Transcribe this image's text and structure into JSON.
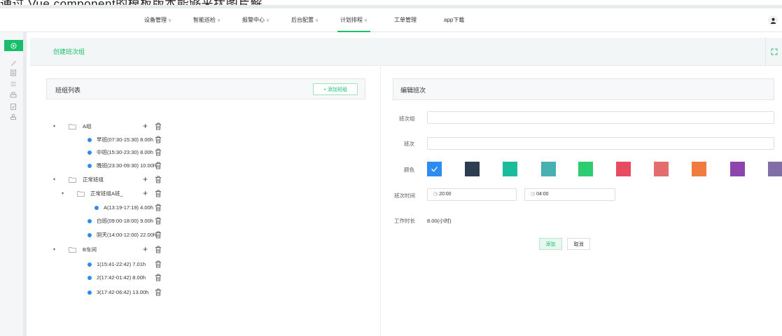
{
  "top_strip_text": "通过 Vue.component的模板版本能够来扰图片解",
  "nav": {
    "items": [
      {
        "label": "设备管理",
        "has_dropdown": true
      },
      {
        "label": "智能巡检",
        "has_dropdown": true
      },
      {
        "label": "报警中心",
        "has_dropdown": true
      },
      {
        "label": "后台配置",
        "has_dropdown": true
      },
      {
        "label": "计划排程",
        "has_dropdown": true,
        "active": true
      },
      {
        "label": "工单管理",
        "has_dropdown": false
      },
      {
        "label": "app下载",
        "has_dropdown": false
      }
    ]
  },
  "sidebar": {
    "icons": [
      "plus-circle-icon",
      "pen-icon",
      "document-icon",
      "list-icon",
      "print-icon",
      "clipboard-check-icon",
      "stamp-icon"
    ]
  },
  "page": {
    "title": "创建班次组"
  },
  "left_panel": {
    "title": "班组列表",
    "add_group_label": "+ 添加班组"
  },
  "tree": [
    {
      "level": 0,
      "type": "group",
      "label": "A组",
      "expanded": true
    },
    {
      "level": 1,
      "type": "shift",
      "label": "早班(07:30-15:30) 8.00h"
    },
    {
      "level": 1,
      "type": "shift",
      "label": "中班(15:30-23:30) 8.00h"
    },
    {
      "level": 1,
      "type": "shift",
      "label": "晚班(23:30-09:30) 10.00h"
    },
    {
      "level": 0,
      "type": "group",
      "label": "正常班组",
      "expanded": true
    },
    {
      "level": 1,
      "type": "group",
      "label": "正常班组A班_",
      "expanded": true
    },
    {
      "level": 2,
      "type": "shift",
      "label": "A(13:19-17:19) 4.00h"
    },
    {
      "level": 1,
      "type": "shift",
      "label": "白班(09:00-18:00) 9.00h"
    },
    {
      "level": 1,
      "type": "shift",
      "label": "阴天(14:00-12:00) 22.00h"
    },
    {
      "level": 0,
      "type": "group",
      "label": "B车间",
      "expanded": true
    },
    {
      "level": 1,
      "type": "shift",
      "label": "1(15:41-22:42) 7.01h"
    },
    {
      "level": 1,
      "type": "shift",
      "label": "2(17:42-01:42) 8.00h"
    },
    {
      "level": 1,
      "type": "shift",
      "label": "3(17:42-06:42) 13.00h"
    }
  ],
  "right_panel": {
    "title": "编辑班次",
    "group_label": "班次组",
    "shift_label": "班次",
    "color_label": "颜色",
    "time_label": "班次时间",
    "start_time": "20:00",
    "end_time": "04:00",
    "duration_label": "工作时长",
    "duration_value": "8.00(小时)",
    "add_button": "添加",
    "cancel_button": "取消"
  },
  "colors": [
    "#2d8cf0",
    "#2c3e50",
    "#1abc9c",
    "#48b0b0",
    "#2ecc71",
    "#e84a5f",
    "#e36c6c",
    "#f07b3f",
    "#8e44ad",
    "#7f6fa6"
  ],
  "selected_color_index": 0,
  "accent_color": "#19be6b"
}
